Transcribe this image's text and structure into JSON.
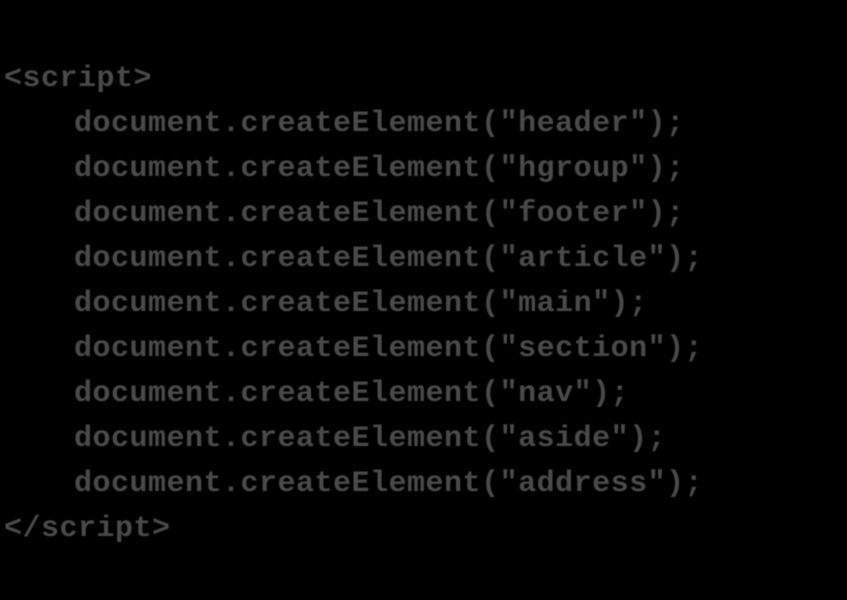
{
  "code": {
    "open_tag": "<script>",
    "lines": [
      "document.createElement(\"header\");",
      "document.createElement(\"hgroup\");",
      "document.createElement(\"footer\");",
      "document.createElement(\"article\");",
      "document.createElement(\"main\");",
      "document.createElement(\"section\");",
      "document.createElement(\"nav\");",
      "document.createElement(\"aside\");",
      "document.createElement(\"address\");"
    ],
    "close_tag": "</script>"
  }
}
